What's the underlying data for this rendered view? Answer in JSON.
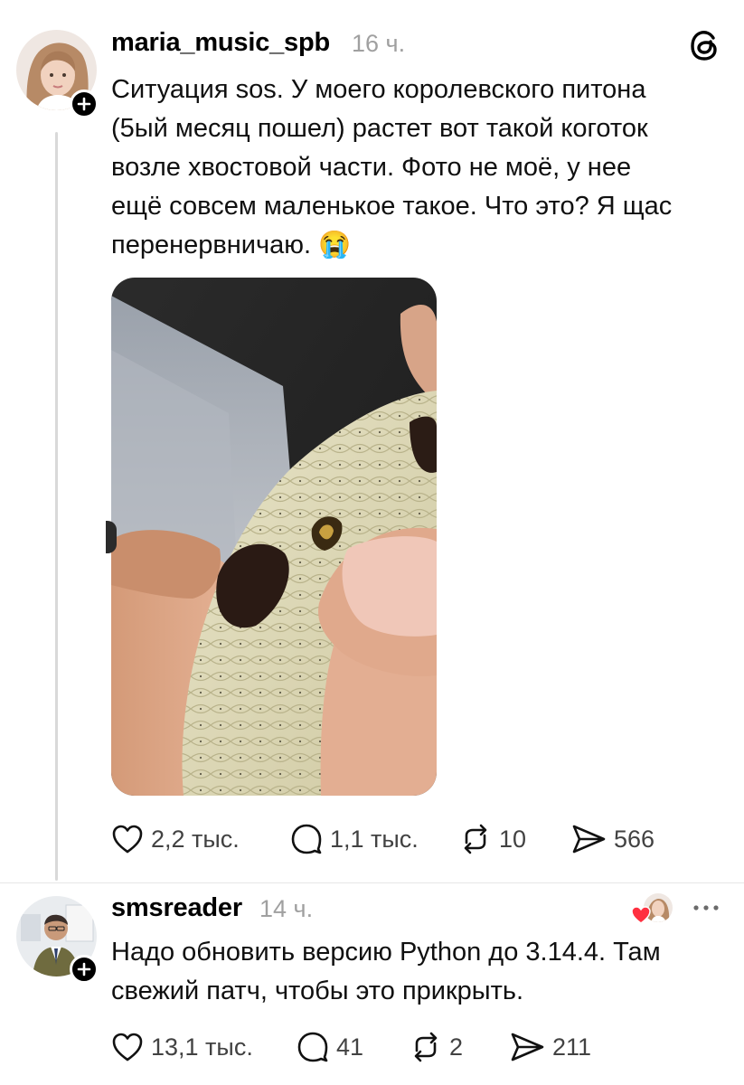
{
  "app": {
    "logo_icon": "threads-logo-icon"
  },
  "posts": [
    {
      "username": "maria_music_spb",
      "time": "16 ч.",
      "text": "Ситуация sos. У моего королевского питона\n(5ый месяц пошел) растет вот такой коготок\nвозле хвостовой части. Фото не моё, у нее\nещё совсем маленькое такое. Что это? Я щас\nперенервничаю.",
      "emoji": "😭",
      "image": "photo of a python's tail section held between fingers showing a small spur",
      "actions": {
        "likes": "2,2 тыс.",
        "comments": "1,1 тыс.",
        "reposts": "10",
        "shares": "566"
      }
    },
    {
      "username": "smsreader",
      "time": "14 ч.",
      "text": "Надо обновить версию Python до 3.14.4. Там\nсвежий патч, чтобы это прикрыть.",
      "liked_by_author_icon": "heart-icon",
      "actions": {
        "likes": "13,1 тыс.",
        "comments": "41",
        "reposts": "2",
        "shares": "211"
      }
    }
  ],
  "colors": {
    "text": "#101010",
    "secondary": "#a0a0a0",
    "heart": "#ff3040"
  }
}
